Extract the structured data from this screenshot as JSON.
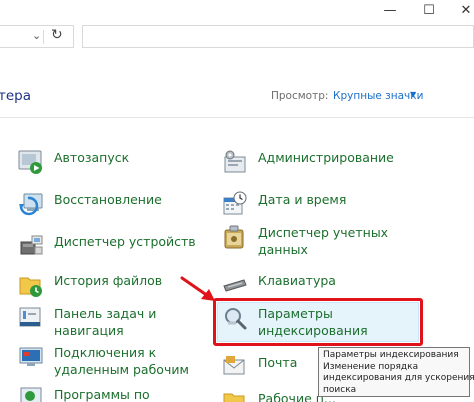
{
  "window": {
    "minimize_glyph": "—",
    "maximize_glyph": "☐",
    "close_glyph": "✕"
  },
  "address_bar": {
    "refresh_glyph": "↻",
    "dropdown_glyph": "⌄"
  },
  "header": {
    "title_fragment": "тера",
    "view_by_label": "Просмотр:",
    "view_by_value": "Крупные значки"
  },
  "items_left": [
    {
      "label": "Автозапуск",
      "icon": "autoplay-icon"
    },
    {
      "label": "Восстановление",
      "icon": "recovery-icon"
    },
    {
      "label": "Диспетчер устройств",
      "icon": "device-manager-icon"
    },
    {
      "label": "История файлов",
      "icon": "file-history-icon"
    },
    {
      "label_line1": "Панель задач и",
      "label_line2": "навигация",
      "icon": "taskbar-icon"
    },
    {
      "label_line1": "Подключения к",
      "label_line2": "удаленным рабочим",
      "icon": "remote-desktop-icon"
    },
    {
      "label": "Программы по",
      "icon": "default-programs-icon"
    }
  ],
  "items_right": [
    {
      "label": "Администрирование",
      "icon": "admin-tools-icon"
    },
    {
      "label": "Дата и время",
      "icon": "date-time-icon"
    },
    {
      "label_line1": "Диспетчер учетных",
      "label_line2": "данных",
      "icon": "credential-manager-icon"
    },
    {
      "label": "Клавиатура",
      "icon": "keyboard-icon"
    },
    {
      "label_line1": "Параметры",
      "label_line2": "индексирования",
      "icon": "indexing-options-icon"
    },
    {
      "label": "Почта",
      "icon": "mail-icon"
    },
    {
      "label": "Рабочие п...",
      "icon": "work-folders-icon"
    }
  ],
  "tooltip": {
    "line1": "Параметры индексирования",
    "line2": "Изменение порядка",
    "line3": "индексирования для ускорения",
    "line4": "поиска"
  },
  "colors": {
    "link_green": "#1b6f2d",
    "title_blue": "#1e3287",
    "accent_blue": "#1a6fc9",
    "highlight_bg": "#e5f3fb",
    "annotation_red": "#e0121a"
  }
}
